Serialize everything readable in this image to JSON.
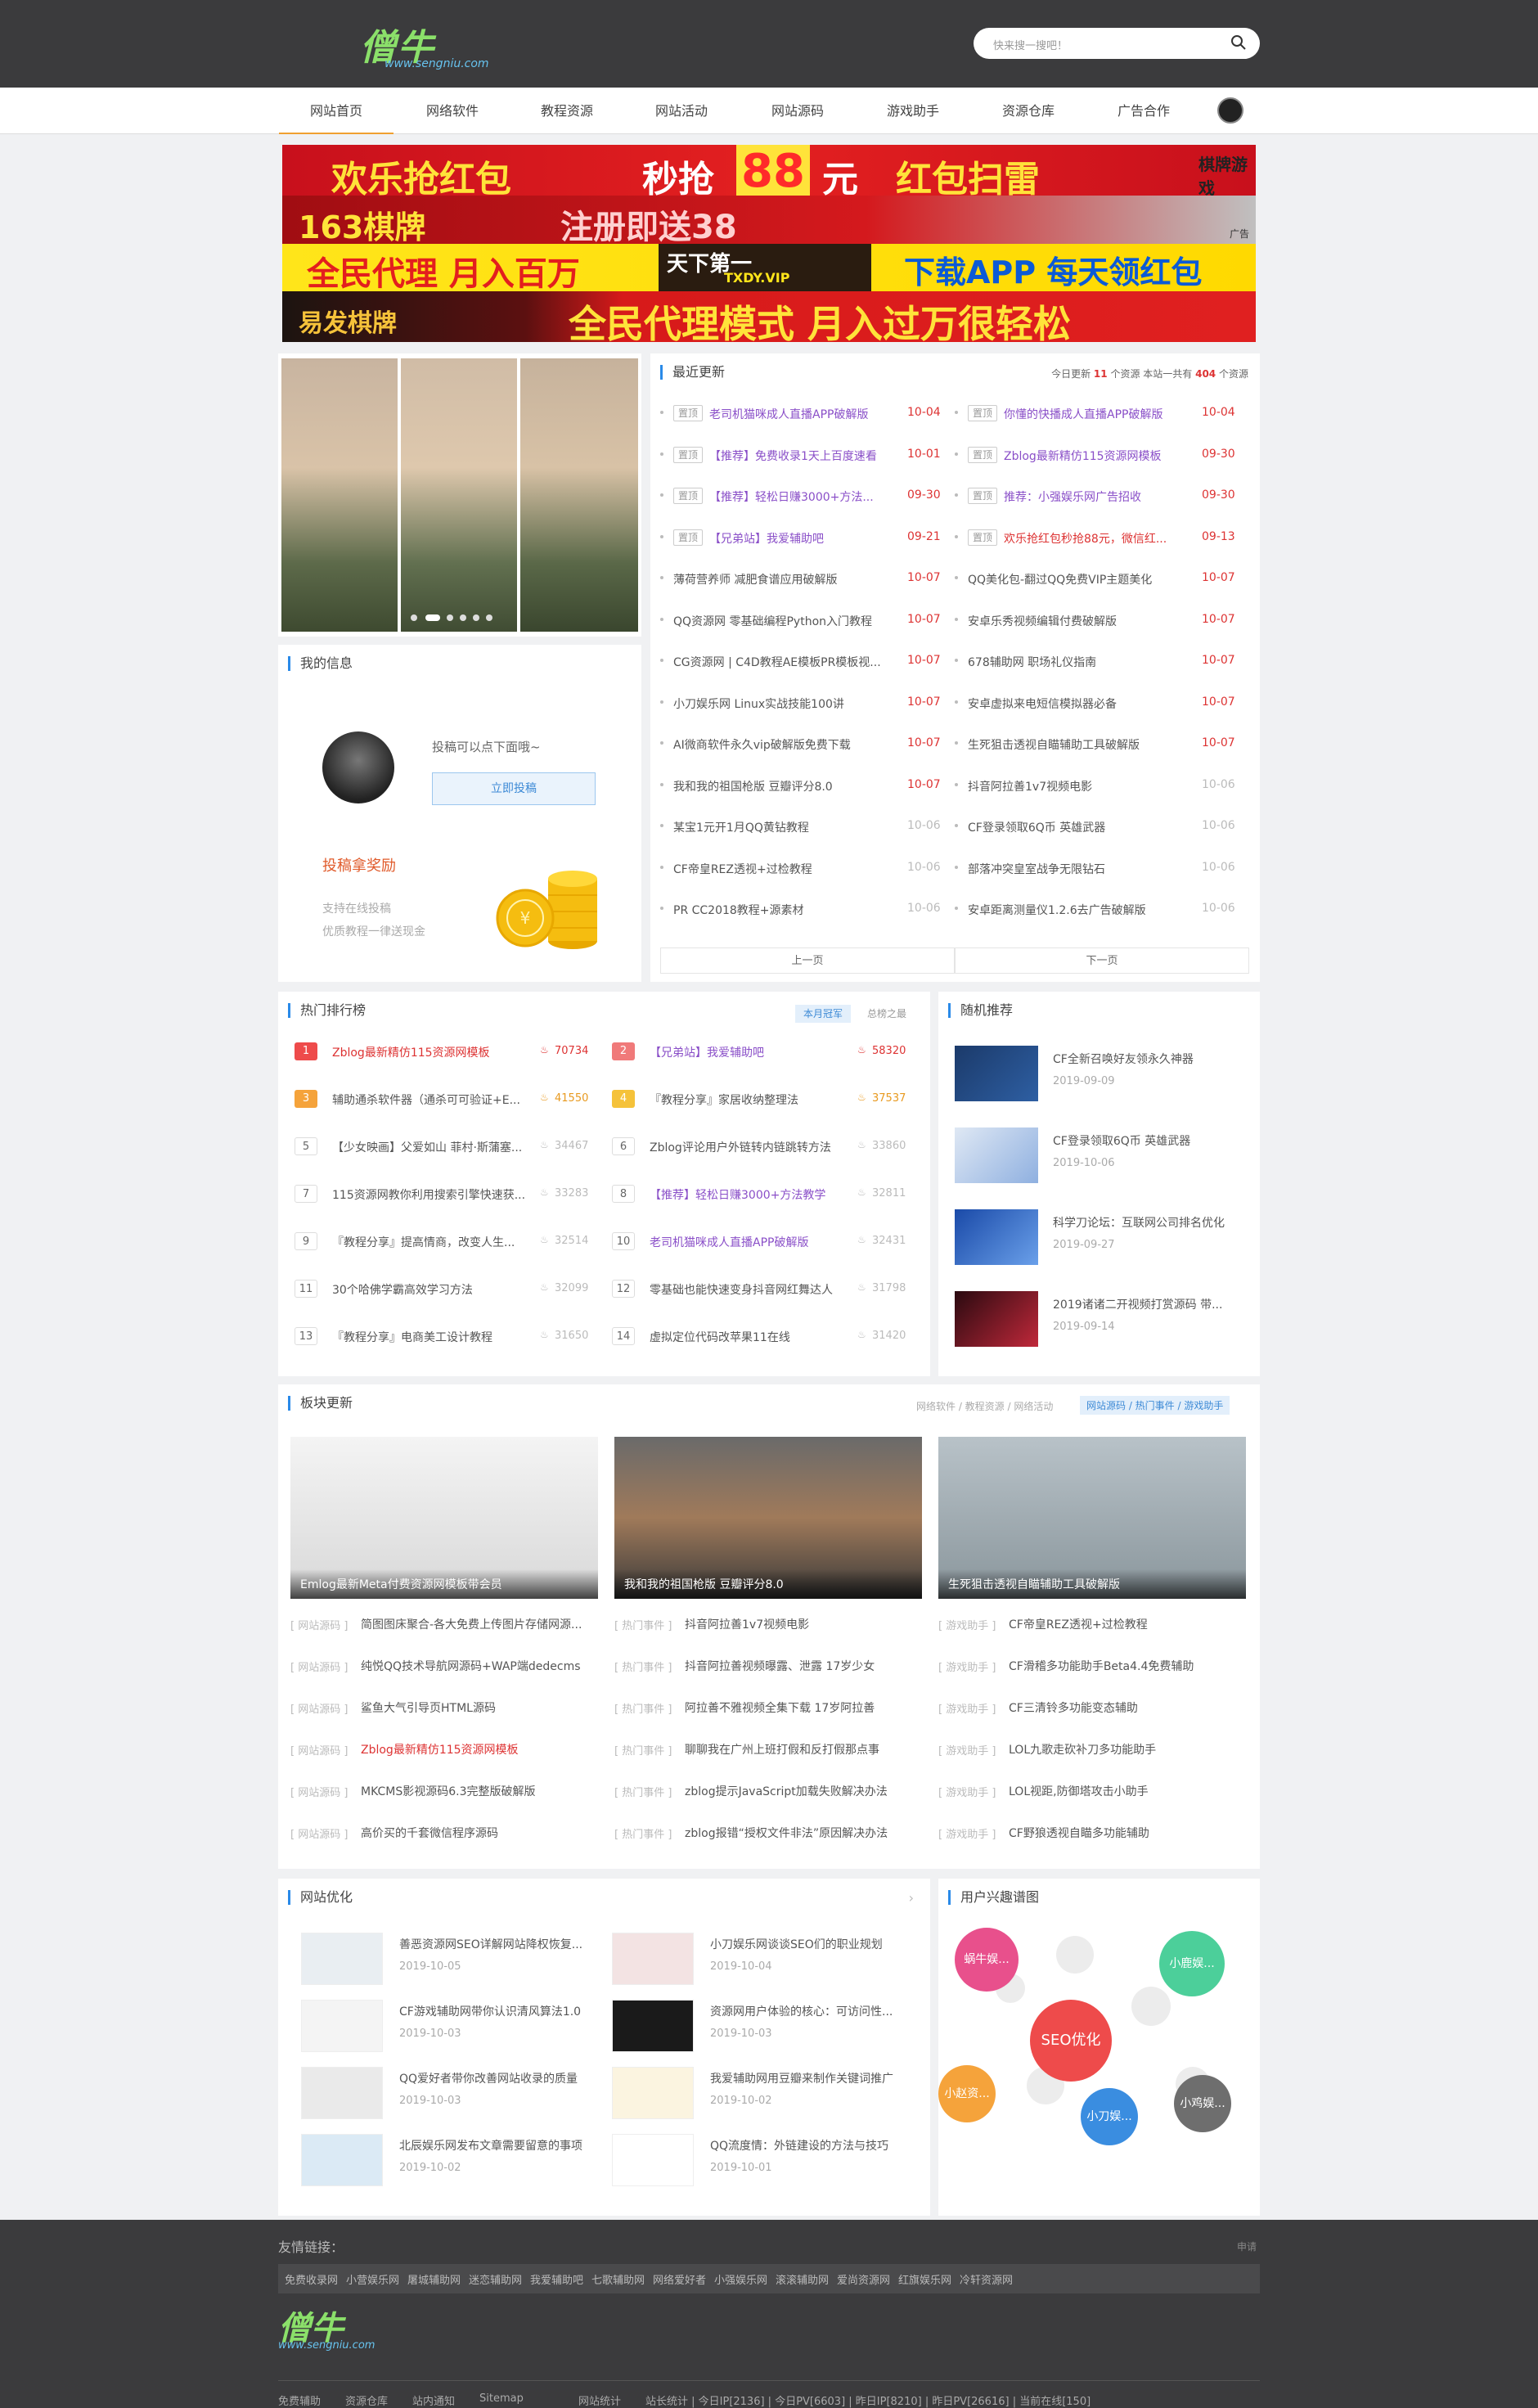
{
  "header": {
    "logo_main": "僧牛",
    "logo_sub": "www.sengniu.com",
    "search_placeholder": "快来搜一搜吧！"
  },
  "nav": {
    "items": [
      "网站首页",
      "网络软件",
      "教程资源",
      "网站活动",
      "网站源码",
      "游戏助手",
      "资源仓库",
      "广告合作"
    ]
  },
  "banners": {
    "b1_a": "欢乐抢红包",
    "b1_b": "秒抢",
    "b1_c": "88",
    "b1_d": "元",
    "b1_e": "红包扫雷",
    "b1_f": "棋牌游戏",
    "b2_a": "163棋牌",
    "b2_b": "注册即送38",
    "b2_c": "广告",
    "b3_a": "全民代理 月入百万",
    "b3_b": "天下第一",
    "b3_c": "TXDY.VIP",
    "b3_d": "下载APP 每天领红包",
    "b4_a": "易发棋牌",
    "b4_b": "全民代理模式 月入过万很轻松"
  },
  "myinfo": {
    "title": "我的信息",
    "tagline": "投稿可以点下面哦~",
    "submit_button": "立即投稿",
    "reward_title": "投稿拿奖励",
    "reward_line1": "支持在线投稿",
    "reward_line2": "优质教程一律送现金"
  },
  "recent": {
    "title": "最近更新",
    "stats_prefix": "今日更新",
    "today_count": "11",
    "stats_mid": "个资源 本站一共有",
    "total_count": "404",
    "stats_suffix": "个资源",
    "sticky_tag": "置顶",
    "left": [
      {
        "text": "老司机猫咪成人直播APP破解版",
        "date": "10-04",
        "sticky": true,
        "style": "purple"
      },
      {
        "text": "【推荐】免费收录1天上百度速看",
        "date": "10-01",
        "sticky": true,
        "style": "purple"
      },
      {
        "text": "【推荐】轻松日赚3000+方法...",
        "date": "09-30",
        "sticky": true,
        "style": "purple"
      },
      {
        "text": "【兄弟站】我爱辅助吧",
        "date": "09-21",
        "sticky": true,
        "style": "purple"
      },
      {
        "text": "薄荷营养师 减肥食谱应用破解版",
        "date": "10-07",
        "sticky": false,
        "style": "red"
      },
      {
        "text": "QQ资源网 零基础编程Python入门教程",
        "date": "10-07",
        "sticky": false,
        "style": "red"
      },
      {
        "text": "CG资源网 | C4D教程AE模板PR模板视...",
        "date": "10-07",
        "sticky": false,
        "style": "red"
      },
      {
        "text": "小刀娱乐网 Linux实战技能100讲",
        "date": "10-07",
        "sticky": false,
        "style": "red"
      },
      {
        "text": "AI微商软件永久vip破解版免费下载",
        "date": "10-07",
        "sticky": false,
        "style": "red"
      },
      {
        "text": "我和我的祖国枪版 豆瓣评分8.0",
        "date": "10-07",
        "sticky": false,
        "style": "red"
      },
      {
        "text": "某宝1元开1月QQ黄钻教程",
        "date": "10-06",
        "sticky": false,
        "style": "muted"
      },
      {
        "text": "CF帝皇REZ透视+过检教程",
        "date": "10-06",
        "sticky": false,
        "style": "muted"
      },
      {
        "text": "PR CC2018教程+源素材",
        "date": "10-06",
        "sticky": false,
        "style": "muted"
      }
    ],
    "right": [
      {
        "text": "你懂的快播成人直播APP破解版",
        "date": "10-04",
        "sticky": true,
        "style": "purple"
      },
      {
        "text": "Zblog最新精仿115资源网模板",
        "date": "09-30",
        "sticky": true,
        "style": "purple"
      },
      {
        "text": "推荐：小强娱乐网广告招收",
        "date": "09-30",
        "sticky": true,
        "style": "purple"
      },
      {
        "text": "欢乐抢红包秒抢88元，微信红...",
        "date": "09-13",
        "sticky": true,
        "style": "red"
      },
      {
        "text": "QQ美化包-翻过QQ免费VIP主题美化",
        "date": "10-07",
        "sticky": false,
        "style": "red"
      },
      {
        "text": "安卓乐秀视频编辑付费破解版",
        "date": "10-07",
        "sticky": false,
        "style": "red"
      },
      {
        "text": "678辅助网 职场礼仪指南",
        "date": "10-07",
        "sticky": false,
        "style": "red"
      },
      {
        "text": "安卓虚拟来电短信模拟器必备",
        "date": "10-07",
        "sticky": false,
        "style": "red"
      },
      {
        "text": "生死狙击透视自瞄辅助工具破解版",
        "date": "10-07",
        "sticky": false,
        "style": "red"
      },
      {
        "text": "抖音阿拉善1v7视频电影",
        "date": "10-06",
        "sticky": false,
        "style": "muted"
      },
      {
        "text": "CF登录领取6Q币 英雄武器",
        "date": "10-06",
        "sticky": false,
        "style": "muted"
      },
      {
        "text": "部落冲突皇室战争无限钻石",
        "date": "10-06",
        "sticky": false,
        "style": "muted"
      },
      {
        "text": "安卓距离测量仪1.2.6去广告破解版",
        "date": "10-06",
        "sticky": false,
        "style": "muted"
      }
    ],
    "prev": "上一页",
    "next": "下一页"
  },
  "hot": {
    "title": "热门排行榜",
    "tab_month": "本月冠军",
    "tab_total": "总榜之最",
    "items": [
      {
        "rank": "1",
        "text": "Zblog最新精仿115资源网模板",
        "count": "70734",
        "style": "red"
      },
      {
        "rank": "2",
        "text": "【兄弟站】我爱辅助吧",
        "count": "58320",
        "style": "purple"
      },
      {
        "rank": "3",
        "text": "辅助通杀软件器（通杀可可验证+E...",
        "count": "41550",
        "style": "plain"
      },
      {
        "rank": "4",
        "text": "『教程分享』家居收纳整理法",
        "count": "37537",
        "style": "plain"
      },
      {
        "rank": "5",
        "text": "【少女映画】父爱如山 菲村·斯蒲塞...",
        "count": "34467",
        "style": "plain"
      },
      {
        "rank": "6",
        "text": "Zblog评论用户外链转内链跳转方法",
        "count": "33860",
        "style": "plain"
      },
      {
        "rank": "7",
        "text": "115资源网教你利用搜索引擎快速获...",
        "count": "33283",
        "style": "plain"
      },
      {
        "rank": "8",
        "text": "【推荐】轻松日赚3000+方法教学",
        "count": "32811",
        "style": "purple"
      },
      {
        "rank": "9",
        "text": "『教程分享』提高情商，改变人生...",
        "count": "32514",
        "style": "plain"
      },
      {
        "rank": "10",
        "text": "老司机猫咪成人直播APP破解版",
        "count": "32431",
        "style": "purple"
      },
      {
        "rank": "11",
        "text": "30个哈佛学霸高效学习方法",
        "count": "32099",
        "style": "plain"
      },
      {
        "rank": "12",
        "text": "零基础也能快速变身抖音网红舞达人",
        "count": "31798",
        "style": "plain"
      },
      {
        "rank": "13",
        "text": "『教程分享』电商美工设计教程",
        "count": "31650",
        "style": "plain"
      },
      {
        "rank": "14",
        "text": "虚拟定位代码改苹果11在线",
        "count": "31420",
        "style": "plain"
      }
    ]
  },
  "random": {
    "title": "随机推荐",
    "items": [
      {
        "text": "CF全新召唤好友领永久神器",
        "date": "2019-09-09"
      },
      {
        "text": "CF登录领取6Q币 英雄武器",
        "date": "2019-10-06"
      },
      {
        "text": "科学刀论坛：互联网公司排名优化",
        "date": "2019-09-27"
      },
      {
        "text": "2019诸诸二开视频打赏源码 带...",
        "date": "2019-09-14"
      }
    ]
  },
  "block": {
    "title": "板块更新",
    "crumb_left": "网络软件 / 教程资源 / 网络活动",
    "crumb_right": "网站源码 / 热门事件 / 游戏助手",
    "columns": [
      {
        "cap": "Emlog最新Meta付费资源网模板带会员",
        "cat": "网站源码",
        "items": [
          "简图图床聚合-各大免费上传图片存储网源...",
          "纯悦QQ技术导航网源码+WAP端dedecms",
          "鲨鱼大气引导页HTML源码",
          "Zblog最新精仿115资源网模板",
          "MKCMS影视源码6.3完整版破解版",
          "高价买的千套微信程序源码"
        ]
      },
      {
        "cap": "我和我的祖国枪版 豆瓣评分8.0",
        "cat": "热门事件",
        "items": [
          "抖音阿拉善1v7视频电影",
          "抖音阿拉善视频曝露、泄露 17岁少女",
          "阿拉善不雅视频全集下载 17岁阿拉善",
          "聊聊我在广州上班打假和反打假那点事",
          "zblog提示JavaScript加载失败解决办法",
          "zblog报错“授权文件非法”原因解决办法"
        ]
      },
      {
        "cap": "生死狙击透视自瞄辅助工具破解版",
        "cat": "游戏助手",
        "items": [
          "CF帝皇REZ透视+过检教程",
          "CF滑稽多功能助手Beta4.4免费辅助",
          "CF三清铃多功能变态辅助",
          "LOL九歌走砍补刀多功能助手",
          "LOL视距,防御塔攻击小助手",
          "CF野狼透视自瞄多功能辅助"
        ]
      }
    ]
  },
  "seo": {
    "title": "网站优化",
    "items": [
      {
        "text": "善恶资源网SEO详解网站降权恢复...",
        "date": "2019-10-05"
      },
      {
        "text": "小刀娱乐网谈谈SEO们的职业规划",
        "date": "2019-10-04"
      },
      {
        "text": "CF游戏辅助网带你认识清风算法1.0",
        "date": "2019-10-03"
      },
      {
        "text": "资源网用户体验的核心：可访问性...",
        "date": "2019-10-03"
      },
      {
        "text": "QQ爱好者带你改善网站收录的质量",
        "date": "2019-10-03"
      },
      {
        "text": "我爱辅助网用豆瓣来制作关键词推广",
        "date": "2019-10-02"
      },
      {
        "text": "北辰娱乐网发布文章需要留意的事项",
        "date": "2019-10-02"
      },
      {
        "text": "QQ流度情：外链建设的方法与技巧",
        "date": "2019-10-01"
      }
    ]
  },
  "interest": {
    "title": "用户兴趣谱图",
    "bubbles": [
      "蜗牛娱...",
      "小鹿娱...",
      "SEO优化",
      "小赵资...",
      "小刀娱...",
      "小鸡娱..."
    ]
  },
  "footer": {
    "links_title": "友情链接：",
    "apply": "申请",
    "links": [
      "免费收录网",
      "小营娱乐网",
      "屠城辅助网",
      "迷恋辅助网",
      "我爱辅助吧",
      "七歌辅助网",
      "网络爱好者",
      "小强娱乐网",
      "滚滚辅助网",
      "爱尚资源网",
      "红旗娱乐网",
      "冷轩资源网"
    ],
    "bottom_links": [
      "免费辅助",
      "资源仓库",
      "站内通知",
      "Sitemap",
      "网站统计"
    ],
    "stats": "站长统计 | 今日IP[2136] | 今日PV[6603] | 昨日IP[8210] | 昨日PV[26616] | 当前在线[150]"
  }
}
